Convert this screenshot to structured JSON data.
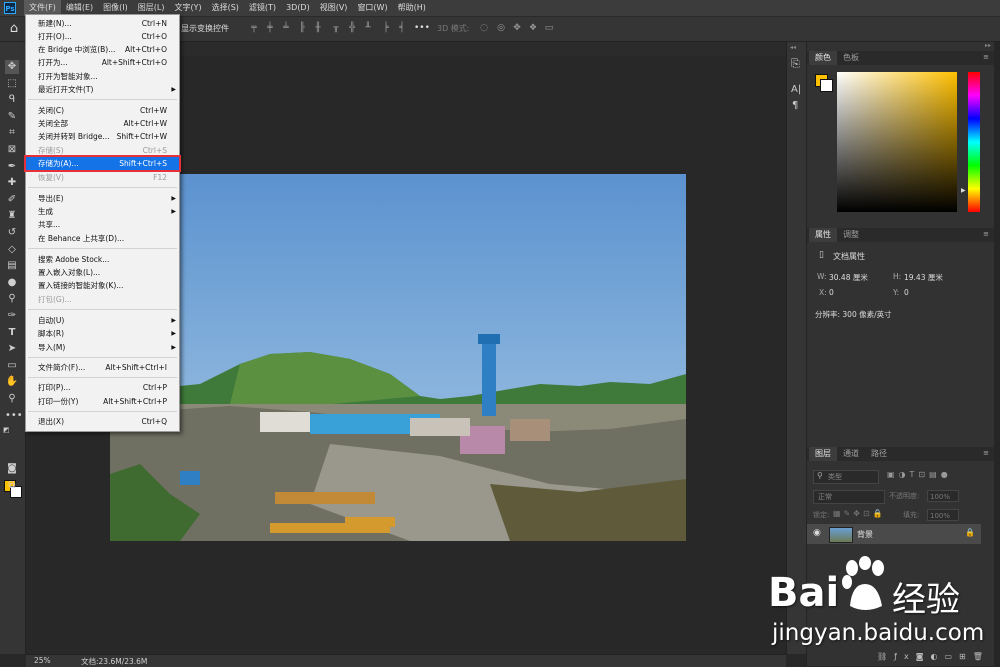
{
  "menubar": {
    "app_icon": "Ps",
    "items": [
      "文件(F)",
      "编辑(E)",
      "图像(I)",
      "图层(L)",
      "文字(Y)",
      "选择(S)",
      "滤镜(T)",
      "3D(D)",
      "视图(V)",
      "窗口(W)",
      "帮助(H)"
    ]
  },
  "options_bar": {
    "show_transform_controls": "显示变换控件",
    "mode_3d": "3D 模式:"
  },
  "file_menu": {
    "items": [
      {
        "label": "新建(N)...",
        "shortcut": "Ctrl+N"
      },
      {
        "label": "打开(O)...",
        "shortcut": "Ctrl+O"
      },
      {
        "label": "在 Bridge 中浏览(B)...",
        "shortcut": "Alt+Ctrl+O"
      },
      {
        "label": "打开为...",
        "shortcut": "Alt+Shift+Ctrl+O"
      },
      {
        "label": "打开为智能对象...",
        "shortcut": ""
      },
      {
        "label": "最近打开文件(T)",
        "shortcut": ""
      },
      {
        "label": "关闭(C)",
        "shortcut": "Ctrl+W"
      },
      {
        "label": "关闭全部",
        "shortcut": "Alt+Ctrl+W"
      },
      {
        "label": "关闭并转到 Bridge...",
        "shortcut": "Shift+Ctrl+W"
      },
      {
        "label": "存储(S)",
        "shortcut": "Ctrl+S"
      },
      {
        "label": "存储为(A)...",
        "shortcut": "Shift+Ctrl+S"
      },
      {
        "label": "恢复(V)",
        "shortcut": "F12"
      },
      {
        "label": "导出(E)",
        "shortcut": ""
      },
      {
        "label": "生成",
        "shortcut": ""
      },
      {
        "label": "共享...",
        "shortcut": ""
      },
      {
        "label": "在 Behance 上共享(D)...",
        "shortcut": ""
      },
      {
        "label": "搜索 Adobe Stock...",
        "shortcut": ""
      },
      {
        "label": "置入嵌入对象(L)...",
        "shortcut": ""
      },
      {
        "label": "置入链接的智能对象(K)...",
        "shortcut": ""
      },
      {
        "label": "打包(G)...",
        "shortcut": ""
      },
      {
        "label": "自动(U)",
        "shortcut": ""
      },
      {
        "label": "脚本(R)",
        "shortcut": ""
      },
      {
        "label": "导入(M)",
        "shortcut": ""
      },
      {
        "label": "文件简介(F)...",
        "shortcut": "Alt+Shift+Ctrl+I"
      },
      {
        "label": "打印(P)...",
        "shortcut": "Ctrl+P"
      },
      {
        "label": "打印一份(Y)",
        "shortcut": "Alt+Shift+Ctrl+P"
      },
      {
        "label": "退出(X)",
        "shortcut": "Ctrl+Q"
      }
    ]
  },
  "color_panel": {
    "tabs": [
      "颜色",
      "色板"
    ],
    "foreground": "#ffc000",
    "background": "#ffffff"
  },
  "properties_panel": {
    "tabs": [
      "属性",
      "调整"
    ],
    "doc_title": "文档属性",
    "w_label": "W:",
    "w_value": "30.48 厘米",
    "h_label": "H:",
    "h_value": "19.43 厘米",
    "x_label": "X:",
    "x_value": "0",
    "y_label": "Y:",
    "y_value": "0",
    "resolution": "分辨率: 300 像素/英寸"
  },
  "layers_panel": {
    "tabs": [
      "图层",
      "通道",
      "路径"
    ],
    "filter_kind": "类型",
    "blend_mode": "正常",
    "opacity_label": "不透明度:",
    "opacity_value": "100%",
    "lock_label": "锁定:",
    "fill_label": "填充:",
    "fill_value": "100%",
    "layer_name": "背景"
  },
  "status": {
    "zoom": "25%",
    "doc_size": "文档:23.6M/23.6M"
  },
  "watermark": {
    "brand_left": "Bai",
    "brand_right": "经验",
    "url": "jingyan.baidu.com"
  }
}
